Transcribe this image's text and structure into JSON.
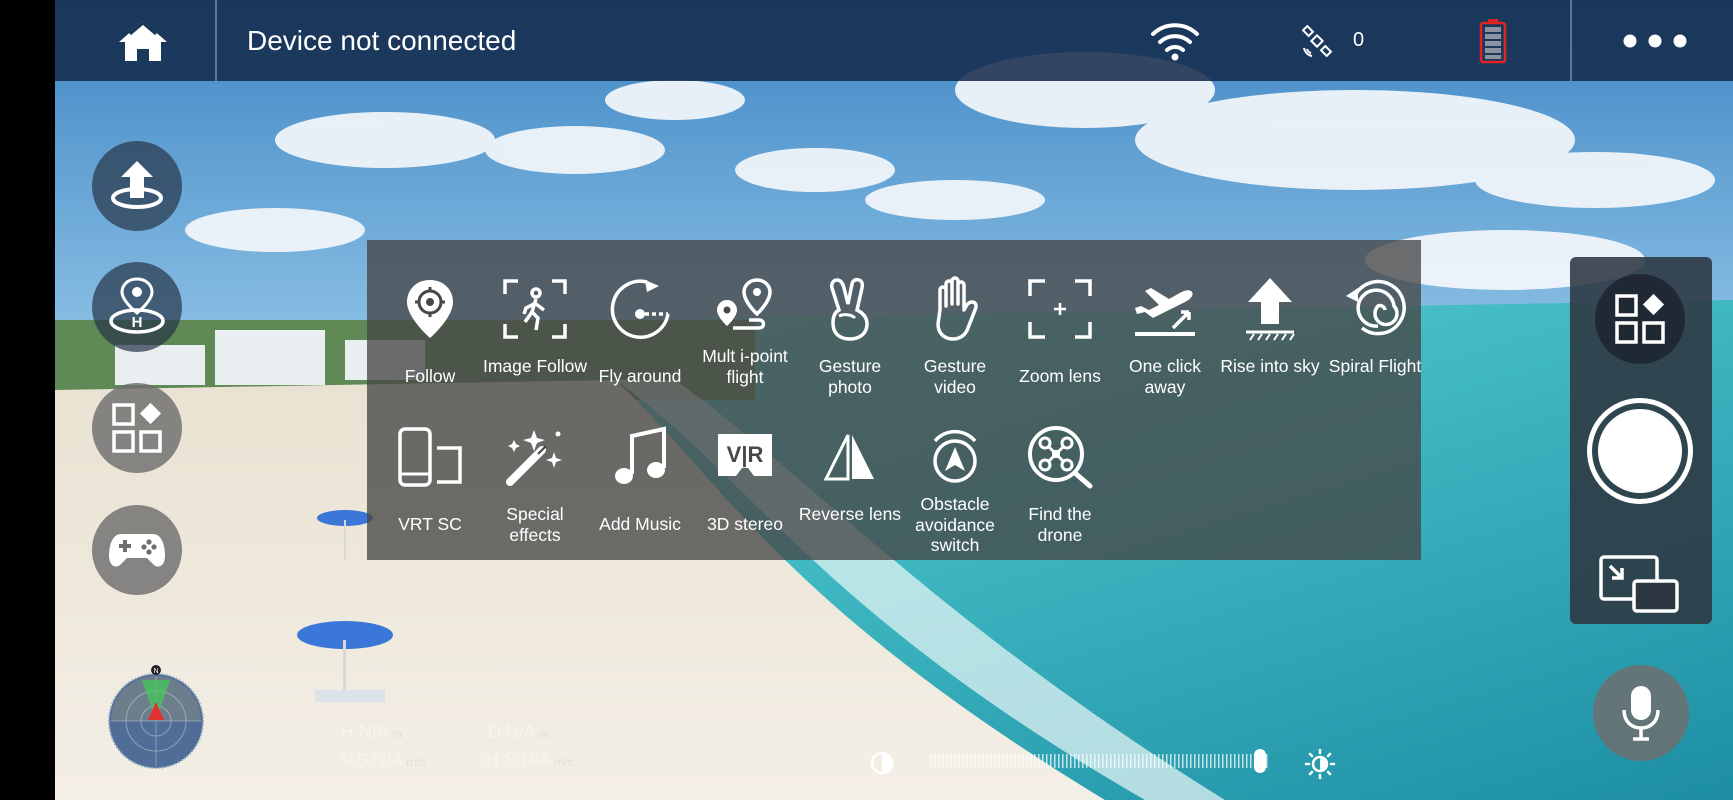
{
  "status": {
    "connection_text": "Device not connected",
    "satellite_count": "0"
  },
  "functions": [
    {
      "id": "follow",
      "label": "Follow"
    },
    {
      "id": "image-follow",
      "label": "Image Follow"
    },
    {
      "id": "fly-around",
      "label": "Fly around"
    },
    {
      "id": "multi-point",
      "label": "Mult i-point flight"
    },
    {
      "id": "gesture-photo",
      "label": "Gesture photo"
    },
    {
      "id": "gesture-video",
      "label": "Gesture video"
    },
    {
      "id": "zoom-lens",
      "label": "Zoom lens"
    },
    {
      "id": "one-click-away",
      "label": "One click away"
    },
    {
      "id": "rise-into-sky",
      "label": "Rise into sky"
    },
    {
      "id": "spiral-flight",
      "label": "Spiral Flight"
    },
    {
      "id": "vrt-sc",
      "label": "VRT SC"
    },
    {
      "id": "special-effects",
      "label": "Special effects"
    },
    {
      "id": "add-music",
      "label": "Add Music"
    },
    {
      "id": "3d-stereo",
      "label": "3D stereo"
    },
    {
      "id": "reverse-lens",
      "label": "Reverse lens"
    },
    {
      "id": "obstacle-avoidance",
      "label": "Obstacle avoidance switch"
    },
    {
      "id": "find-drone",
      "label": "Find the drone"
    }
  ],
  "telemetry": {
    "height": {
      "label": "H:N/A",
      "unit": "m"
    },
    "distance": {
      "label": "D:N/A",
      "unit": "m"
    },
    "vertical_speed": {
      "label": "V.S:N/A",
      "unit": "m/s"
    },
    "horizontal_speed": {
      "label": "H.S:N/A",
      "unit": "m/s"
    }
  },
  "compass": {
    "north_label": "N"
  },
  "brightness": {
    "level_percent": 97
  }
}
